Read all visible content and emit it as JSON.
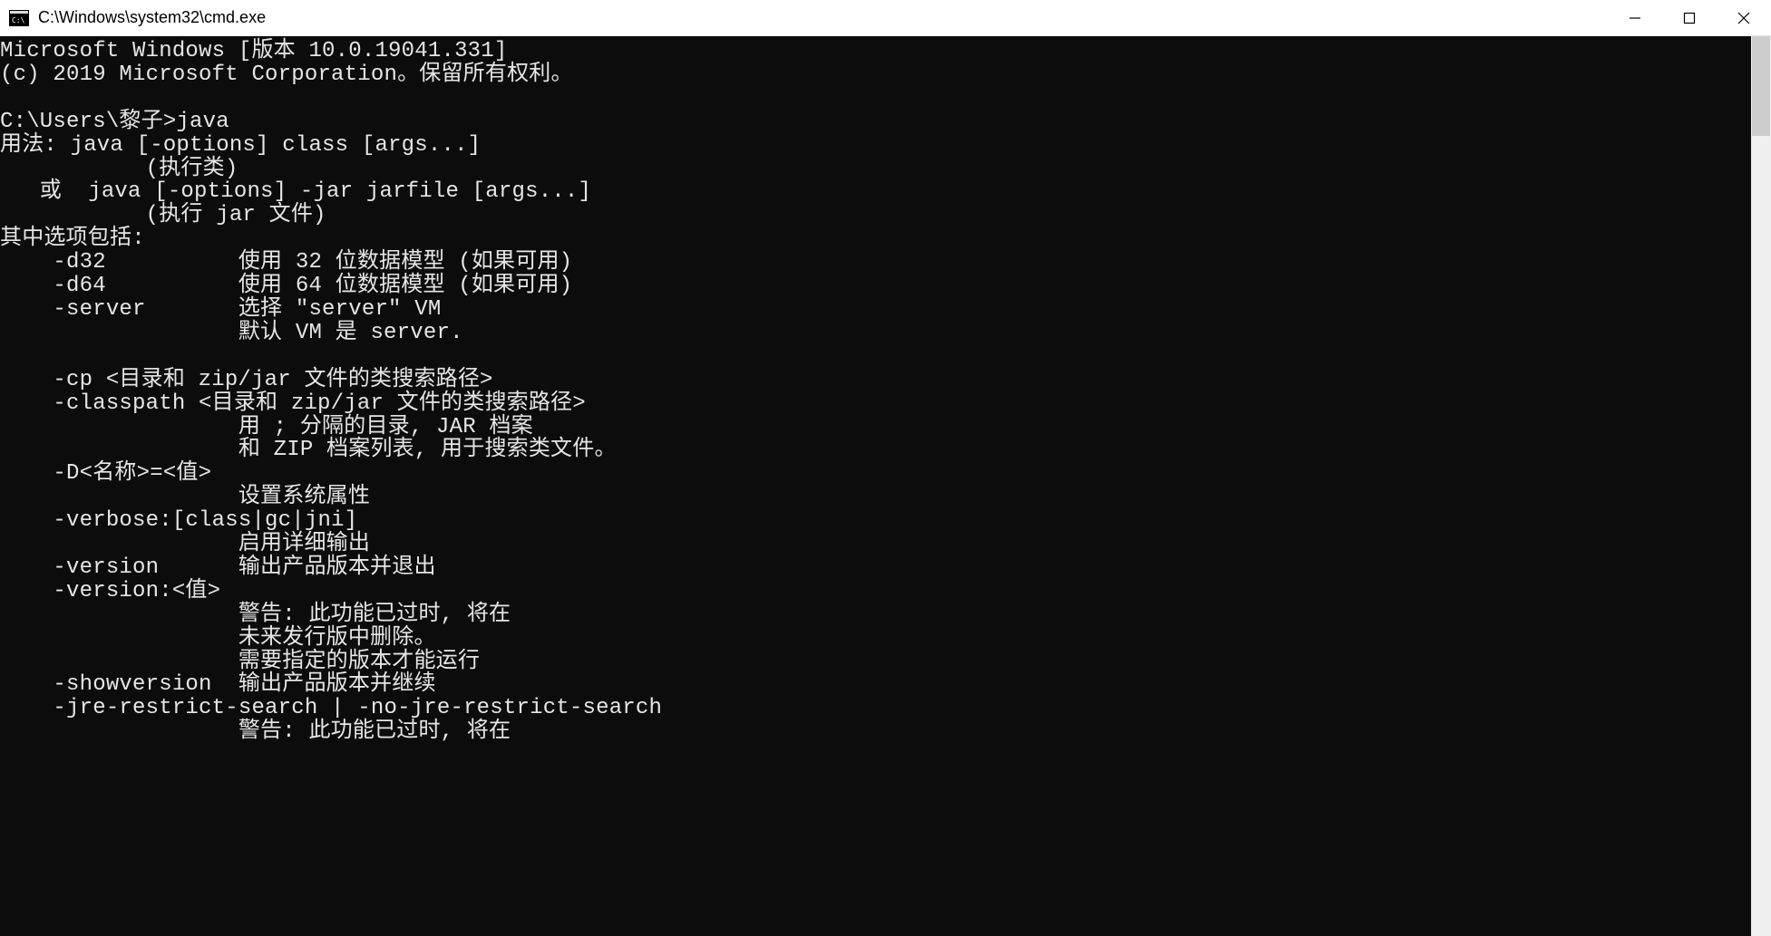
{
  "window": {
    "title": "C:\\Windows\\system32\\cmd.exe"
  },
  "terminal": {
    "lines": [
      "Microsoft Windows [版本 10.0.19041.331]",
      "(c) 2019 Microsoft Corporation。保留所有权利。",
      "",
      "C:\\Users\\黎子>java",
      "用法: java [-options] class [args...]",
      "           (执行类)",
      "   或  java [-options] -jar jarfile [args...]",
      "           (执行 jar 文件)",
      "其中选项包括:",
      "    -d32          使用 32 位数据模型 (如果可用)",
      "    -d64          使用 64 位数据模型 (如果可用)",
      "    -server       选择 \"server\" VM",
      "                  默认 VM 是 server.",
      "",
      "    -cp <目录和 zip/jar 文件的类搜索路径>",
      "    -classpath <目录和 zip/jar 文件的类搜索路径>",
      "                  用 ; 分隔的目录, JAR 档案",
      "                  和 ZIP 档案列表, 用于搜索类文件。",
      "    -D<名称>=<值>",
      "                  设置系统属性",
      "    -verbose:[class|gc|jni]",
      "                  启用详细输出",
      "    -version      输出产品版本并退出",
      "    -version:<值>",
      "                  警告: 此功能已过时, 将在",
      "                  未来发行版中删除。",
      "                  需要指定的版本才能运行",
      "    -showversion  输出产品版本并继续",
      "    -jre-restrict-search | -no-jre-restrict-search",
      "                  警告: 此功能已过时, 将在"
    ]
  }
}
